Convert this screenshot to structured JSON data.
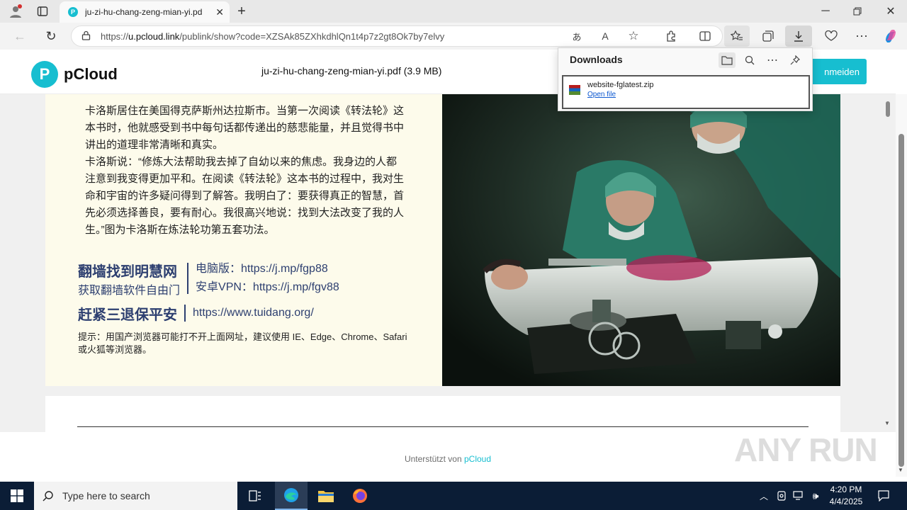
{
  "browser": {
    "tab_title": "ju-zi-hu-chang-zeng-mian-yi.pd",
    "tab_favicon": "P",
    "url_prefix": "https://",
    "url_host": "u.pcloud.link",
    "url_path": "/publink/show?code=XZSAk85ZXhkdhlQn1t4p7z2gt8Ok7by7elvy"
  },
  "pcloud": {
    "brand": "pCloud",
    "logo_letter": "P",
    "doc_title": "ju-zi-hu-chang-zeng-mian-yi.pdf (3.9 MB)",
    "login_label": "nmeiden",
    "accent": "#17bed0"
  },
  "pdf": {
    "para1": "卡洛斯居住在美国得克萨斯州达拉斯市。当第一次阅读《转法轮》这本书时，他就感受到书中每句话都传递出的慈悲能量，并且觉得书中讲出的道理非常清晰和真实。",
    "para2": "卡洛斯说：“修炼大法帮助我去掉了自幼以来的焦虑。我身边的人都注意到我变得更加平和。在阅读《转法轮》这本书的过程中，我对生命和宇宙的许多疑问得到了解答。我明白了：要获得真正的智慧，首先必须选择善良，要有耐心。我很高兴地说：找到大法改变了我的人生。”图为卡洛斯在炼法轮功第五套功法。",
    "big1": "翻墙找到明慧网",
    "small1": "获取翻墙软件自由门",
    "link1": "电脑版：https://j.mp/fgp88",
    "link2": "安卓VPN：https://j.mp/fgv88",
    "big2": "赶紧三退保平安",
    "link3": "https://www.tuidang.org/",
    "hint": "提示：用国产浏览器可能打不开上面网址，建议使用 IE、Edge、Chrome、Safari 或火狐等浏览器。"
  },
  "downloads": {
    "title": "Downloads",
    "file_name": "website-fglatest.zip",
    "open_file": "Open file"
  },
  "footer": {
    "prefix": "Unterstützt von",
    "brand": "pCloud"
  },
  "watermark": "ANY RUN",
  "taskbar": {
    "search_placeholder": "Type here to search",
    "time": "4:20 PM",
    "date": "4/4/2025"
  }
}
